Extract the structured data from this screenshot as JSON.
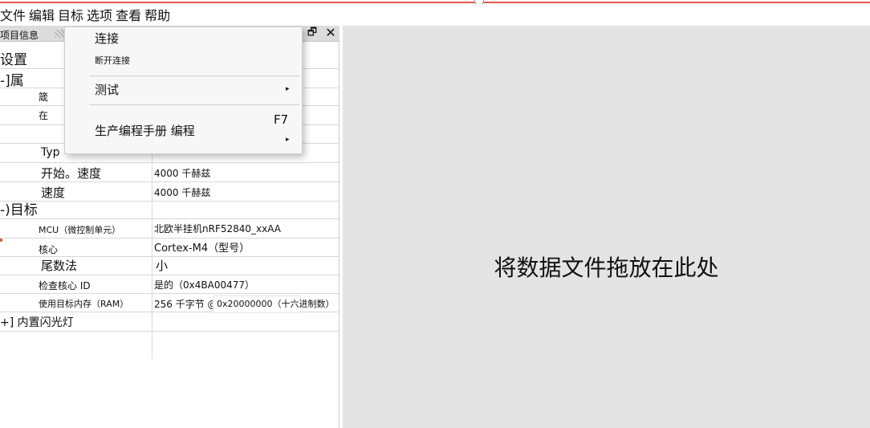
{
  "menubar": [
    "文件",
    "编辑",
    "目标",
    "选项",
    "查看",
    "帮助"
  ],
  "panel": {
    "title": "项目信息",
    "restore_glyph": "🗗",
    "close_glyph": "✕"
  },
  "tree": {
    "settings": "设置",
    "props": "-]属",
    "prop_row1": "箴",
    "prop_row2": "在",
    "type_label": "Typ",
    "start_speed_label": "开始。速度",
    "start_speed_value": "4000 千赫兹",
    "speed_label": "速度",
    "speed_value": "4000 千赫兹",
    "target": "-)目标",
    "mcu_label": "MCU（微控制单元）",
    "mcu_value": "北欧半挂机nRF52840_xxAA",
    "core_label": "核心",
    "core_value": "Cortex-M4（型号）",
    "endian_label": "尾数法",
    "endian_value": "小",
    "check_core_label": "检查核心 ID",
    "check_core_value": "是的（0x4BA00477）",
    "ram_label": "使用目标内存（RAM）",
    "ram_value": "256 千字节 @",
    "ram_addr": "0x20000000（十六进制数）",
    "flash": "+] 内置闪光灯"
  },
  "context_menu": {
    "connect": "连接",
    "disconnect": "断开连接",
    "test": "测试",
    "production": "生产编程手册 编程",
    "shortcut": "F7",
    "arrow": "▸"
  },
  "drop_area": {
    "text": "将数据文件拖放在此处"
  }
}
